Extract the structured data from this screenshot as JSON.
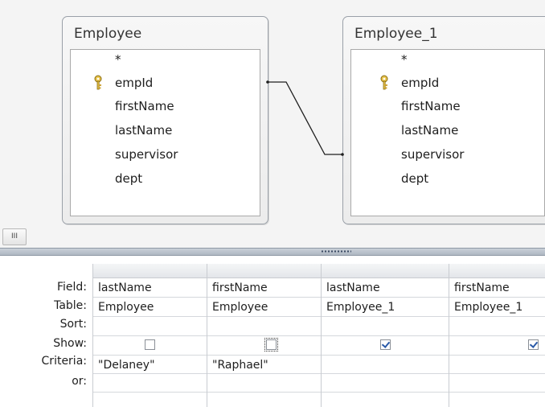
{
  "tables": [
    {
      "title": "Employee",
      "fields": [
        "*",
        "empId",
        "firstName",
        "lastName",
        "supervisor",
        "dept"
      ]
    },
    {
      "title": "Employee_1",
      "fields": [
        "*",
        "empId",
        "firstName",
        "lastName",
        "supervisor",
        "dept"
      ]
    }
  ],
  "scroll_thumb": "III",
  "grid": {
    "row_labels": {
      "field": "Field:",
      "table": "Table:",
      "sort": "Sort:",
      "show": "Show:",
      "criteria": "Criteria:",
      "or": "or:"
    },
    "columns": [
      {
        "field": "lastName",
        "table": "Employee",
        "sort": "",
        "show": false,
        "criteria": "\"Delaney\"",
        "or": ""
      },
      {
        "field": "firstName",
        "table": "Employee",
        "sort": "",
        "show": false,
        "criteria": "\"Raphael\"",
        "or": ""
      },
      {
        "field": "lastName",
        "table": "Employee_1",
        "sort": "",
        "show": true,
        "criteria": "",
        "or": ""
      },
      {
        "field": "firstName",
        "table": "Employee_1",
        "sort": "",
        "show": true,
        "criteria": "",
        "or": ""
      }
    ]
  }
}
